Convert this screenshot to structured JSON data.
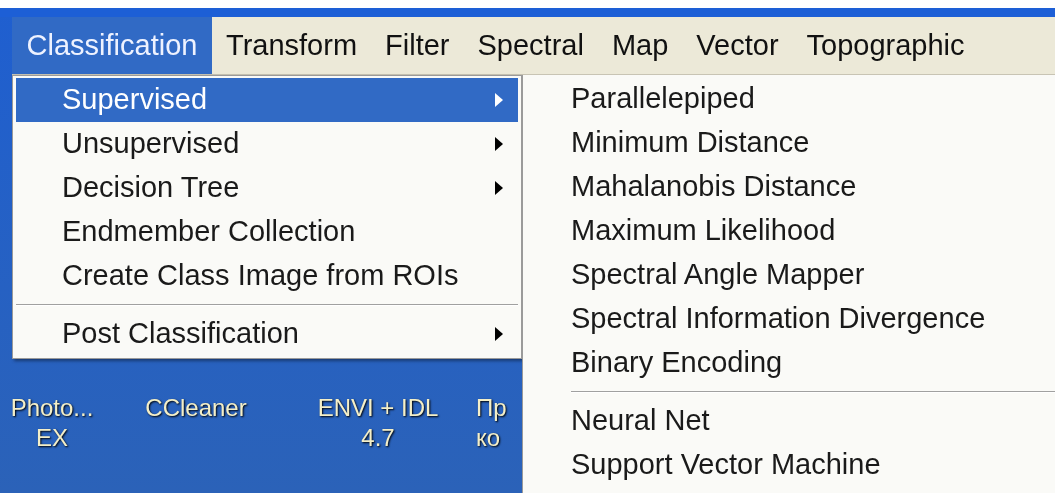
{
  "menu_bar": [
    {
      "label": "Classification",
      "selected": true
    },
    {
      "label": "Transform",
      "selected": false
    },
    {
      "label": "Filter",
      "selected": false
    },
    {
      "label": "Spectral",
      "selected": false
    },
    {
      "label": "Map",
      "selected": false
    },
    {
      "label": "Vector",
      "selected": false
    },
    {
      "label": "Topographic",
      "selected": false
    }
  ],
  "classification_menu": [
    {
      "kind": "item",
      "label": "Supervised",
      "submenu": true,
      "selected": true
    },
    {
      "kind": "item",
      "label": "Unsupervised",
      "submenu": true,
      "selected": false
    },
    {
      "kind": "item",
      "label": "Decision Tree",
      "submenu": true,
      "selected": false
    },
    {
      "kind": "item",
      "label": "Endmember Collection",
      "submenu": false,
      "selected": false
    },
    {
      "kind": "item",
      "label": "Create Class Image from ROIs",
      "submenu": false,
      "selected": false
    },
    {
      "kind": "separator"
    },
    {
      "kind": "item",
      "label": "Post Classification",
      "submenu": true,
      "selected": false
    }
  ],
  "supervised_menu": [
    {
      "kind": "item",
      "label": "Parallelepiped"
    },
    {
      "kind": "item",
      "label": "Minimum Distance"
    },
    {
      "kind": "item",
      "label": "Mahalanobis Distance"
    },
    {
      "kind": "item",
      "label": "Maximum Likelihood"
    },
    {
      "kind": "item",
      "label": "Spectral Angle Mapper"
    },
    {
      "kind": "item",
      "label": "Spectral Information Divergence"
    },
    {
      "kind": "item",
      "label": "Binary Encoding"
    },
    {
      "kind": "separator"
    },
    {
      "kind": "item",
      "label": "Neural Net"
    },
    {
      "kind": "item",
      "label": "Support Vector Machine"
    }
  ],
  "desktop_icons": [
    {
      "lines": [
        "Photo...",
        "EX"
      ]
    },
    {
      "lines": [
        "CCleaner"
      ]
    },
    {
      "lines": [
        "ENVI + IDL",
        "4.7"
      ]
    },
    {
      "lines": [
        "Пр",
        "ко"
      ]
    }
  ]
}
